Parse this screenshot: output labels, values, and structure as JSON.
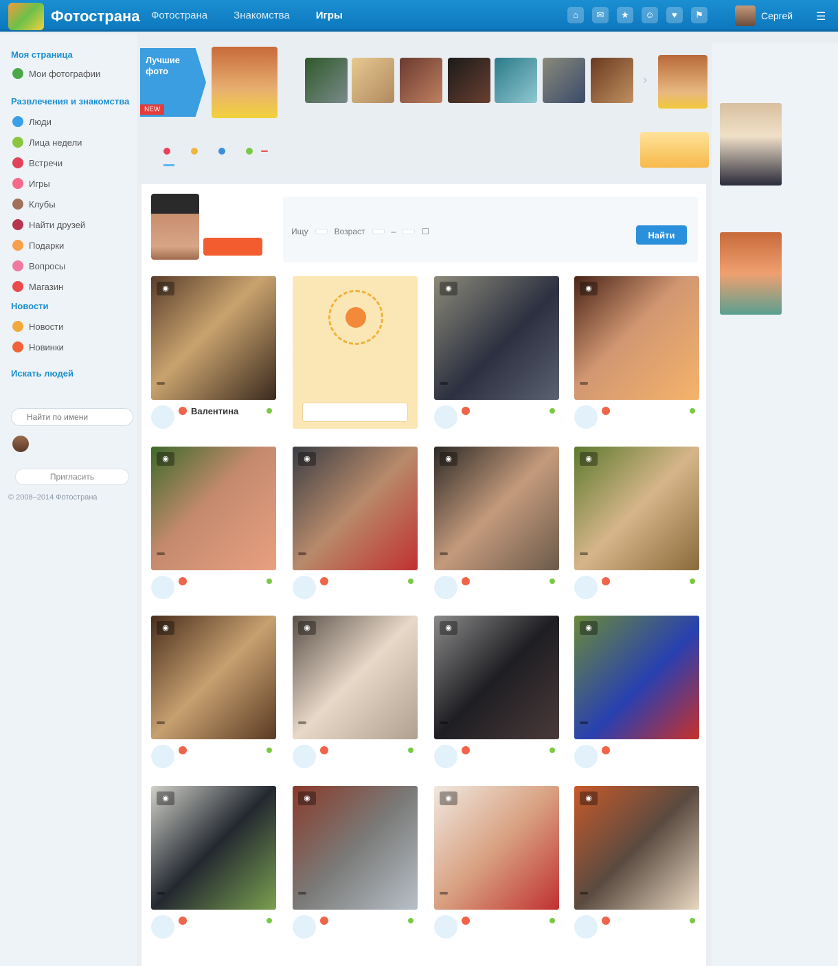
{
  "topbar": {
    "brand": "Фотострана",
    "nav": [
      {
        "label": "Фотострана",
        "active": false
      },
      {
        "label": "Знакомства",
        "active": false
      },
      {
        "label": "Игры",
        "active": true
      }
    ],
    "user_name": "Сергей",
    "icons": [
      "home-icon",
      "messages-icon",
      "events-icon",
      "guests-icon",
      "likes-icon",
      "notifications-icon"
    ]
  },
  "sidebar": {
    "heading_mine": "Моя страница",
    "my_photos": "Мои фотографии",
    "heading_games": "Развлечения и знакомства",
    "items": [
      {
        "label": "Люди",
        "count": "",
        "color": "#3aa0e8"
      },
      {
        "label": "Лица недели",
        "count": "",
        "color": "#8cc63f"
      },
      {
        "label": "Встречи",
        "count": "",
        "color": "#e0435a"
      },
      {
        "label": "Игры",
        "count": "",
        "color": "#f36a8a"
      },
      {
        "label": "Клубы",
        "count": "",
        "color": "#a0705a"
      },
      {
        "label": "Найти друзей",
        "count": "",
        "color": "#b5364d"
      },
      {
        "label": "Подарки",
        "count": "",
        "color": "#f6a04d"
      },
      {
        "label": "Вопросы",
        "count": "",
        "color": "#ef7aa0"
      },
      {
        "label": "Магазин",
        "count": "",
        "color": "#e94b4b"
      }
    ],
    "heading_news": "Новости",
    "news_items": [
      {
        "label": "Новости",
        "count": "",
        "color": "#f2a93b"
      },
      {
        "label": "Новинки",
        "count": "",
        "color": "#f06238"
      }
    ],
    "heading_search": "Искать людей",
    "search_hint": "",
    "search_placeholder": "Найти по имени",
    "friend_name": "",
    "invite_label": "Пригласить",
    "footer": "© 2008–2014 Фотострана"
  },
  "strip": {
    "promo_title": "Лучшие фото",
    "promo_badge": "NEW"
  },
  "tabs": [
    {
      "label": "",
      "color": "",
      "active": false
    },
    {
      "label": "",
      "color": "#e8435a",
      "active": true
    },
    {
      "label": "",
      "color": "#f2b53b",
      "active": false
    },
    {
      "label": "",
      "color": "#3a8ede",
      "active": false
    },
    {
      "label": "",
      "color": "#7ac943",
      "active": false,
      "badge": ""
    }
  ],
  "tab_promo": "",
  "me": {
    "lines": [
      "",
      "",
      ""
    ],
    "button": ""
  },
  "filter": {
    "label_who": "Ищу",
    "who": "",
    "label_age": "Возраст",
    "age_from": "",
    "age_to": "",
    "online_label": "",
    "submit": "Найти",
    "more": ""
  },
  "promo_tile": {
    "title": "",
    "text": "",
    "button": ""
  },
  "cards": [
    {
      "name": "Валентина",
      "meta": "",
      "count": "",
      "online": true,
      "photo": "linear-gradient(135deg,#5a3d2b,#c9a36e 45%,#3b2a1f)"
    },
    {
      "name": "",
      "meta": "",
      "count": "",
      "online": true,
      "photo": "linear-gradient(135deg,#8c8a7a,#2c3040 55%,#5b6171)"
    },
    {
      "name": "",
      "meta": "",
      "count": "",
      "online": true,
      "photo": "linear-gradient(135deg,#4a2418,#d29772 45%,#f5b36a)"
    },
    {
      "name": "",
      "meta": "",
      "count": "",
      "online": true,
      "photo": "linear-gradient(135deg,#3d6a2a,#c58a6e 45%,#e8a080)"
    },
    {
      "name": "",
      "meta": "",
      "count": "",
      "online": true,
      "photo": "linear-gradient(135deg,#3a3d44,#b88a6b 50%,#c13030)"
    },
    {
      "name": "",
      "meta": "",
      "count": "",
      "online": true,
      "photo": "linear-gradient(135deg,#2d2a26,#c49a7c 50%,#6b5a4a)"
    },
    {
      "name": "",
      "meta": "",
      "count": "",
      "online": true,
      "photo": "linear-gradient(135deg,#5d7a2e,#d6b58a 50%,#8a6a3a)"
    },
    {
      "name": "",
      "meta": "",
      "count": "",
      "online": true,
      "photo": "linear-gradient(135deg,#4a2e1c,#c7a070 50%,#5a3a22)"
    },
    {
      "name": "",
      "meta": "",
      "count": "",
      "online": true,
      "photo": "linear-gradient(135deg,#5a5048,#e8d8c8 50%,#b0a090)"
    },
    {
      "name": "",
      "meta": "",
      "count": "",
      "online": true,
      "photo": "linear-gradient(135deg,#8a8a8a,#1e1e22 50%,#4a3a3a)"
    },
    {
      "name": "",
      "meta": "",
      "count": "",
      "online": false,
      "photo": "linear-gradient(135deg,#6a8a3a,#2840b0 55%,#c8302a)"
    },
    {
      "name": "",
      "meta": "",
      "count": "",
      "online": true,
      "photo": "linear-gradient(135deg,#d0d0c8,#232830 50%,#7aa050)"
    },
    {
      "name": "",
      "meta": "",
      "count": "",
      "online": true,
      "photo": "linear-gradient(135deg,#8a3a2a,#7a7a78 50%,#b8c0c8)"
    },
    {
      "name": "",
      "meta": "",
      "count": "",
      "online": true,
      "photo": "linear-gradient(135deg,#f0e8e0,#d8a080 50%,#c03030)"
    },
    {
      "name": "",
      "meta": "",
      "count": "",
      "online": true,
      "photo": "linear-gradient(135deg,#c85a2a,#5a4a40 50%,#e8d8c0)"
    }
  ],
  "right": {
    "title": "",
    "links": [
      "",
      "",
      ""
    ]
  }
}
